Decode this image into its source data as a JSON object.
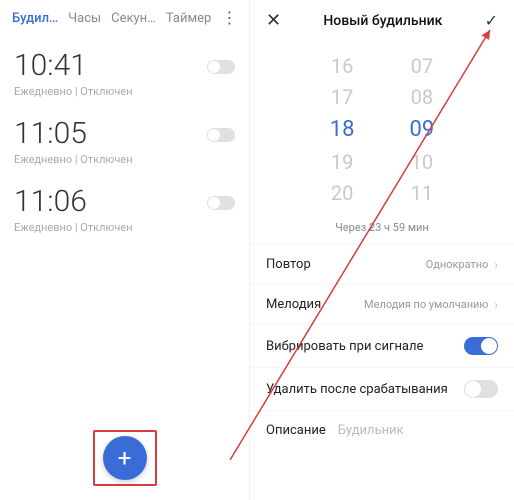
{
  "tabs": {
    "alarm": "Будил…",
    "clock": "Часы",
    "seconds": "Секун…",
    "timer": "Таймер"
  },
  "alarms": [
    {
      "time": "10:41",
      "sub": "Ежедневно | Отключен"
    },
    {
      "time": "11:05",
      "sub": "Ежедневно | Отключен"
    },
    {
      "time": "11:06",
      "sub": "Ежедневно | Отключен"
    }
  ],
  "new_alarm": {
    "title": "Новый будильник",
    "hours": [
      "16",
      "17",
      "18",
      "19",
      "20"
    ],
    "minutes": [
      "07",
      "08",
      "09",
      "10",
      "11"
    ],
    "selected_hour_index": 2,
    "selected_min_index": 2,
    "time_until": "Через 23 ч 59 мин",
    "repeat_label": "Повтор",
    "repeat_value": "Однократно",
    "melody_label": "Мелодия",
    "melody_value": "Мелодия по умолчанию",
    "vibrate_label": "Вибрировать при сигнале",
    "delete_after_label": "Удалить после срабатывания",
    "desc_label": "Описание",
    "desc_placeholder": "Будильник"
  }
}
